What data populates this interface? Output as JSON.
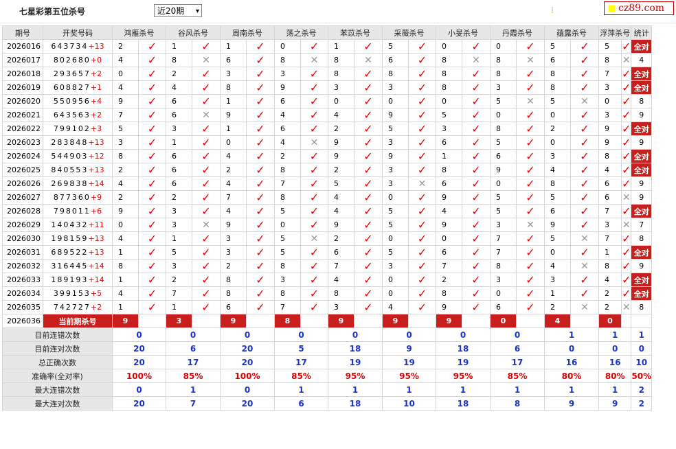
{
  "header": {
    "title": "七星彩第五位杀号",
    "select_value": "近20期",
    "logo_text": "cz89.com"
  },
  "columns": [
    "期号",
    "开奖号码",
    "鸿雁杀号",
    "谷风杀号",
    "周南杀号",
    "荡之杀号",
    "苯苡杀号",
    "采薇杀号",
    "小旻杀号",
    "丹霞杀号",
    "蕴露杀号",
    "浮萍杀号",
    "统计"
  ],
  "hit_symbol": "✓",
  "miss_symbol": "✕",
  "rows": [
    {
      "period": "2026016",
      "digits": "643734",
      "plus": "+13",
      "v": [
        "2",
        "1",
        "1",
        "0",
        "1",
        "5",
        "0",
        "0",
        "5",
        "5"
      ],
      "r": [
        1,
        1,
        1,
        1,
        1,
        1,
        1,
        1,
        1,
        1
      ],
      "stat": "全对"
    },
    {
      "period": "2026017",
      "digits": "802680",
      "plus": "+0",
      "v": [
        "4",
        "8",
        "6",
        "8",
        "8",
        "6",
        "8",
        "8",
        "6",
        "8"
      ],
      "r": [
        1,
        0,
        1,
        0,
        0,
        1,
        0,
        0,
        1,
        0
      ],
      "stat": "4"
    },
    {
      "period": "2026018",
      "digits": "293657",
      "plus": "+2",
      "v": [
        "0",
        "2",
        "3",
        "3",
        "8",
        "8",
        "8",
        "8",
        "8",
        "7"
      ],
      "r": [
        1,
        1,
        1,
        1,
        1,
        1,
        1,
        1,
        1,
        1
      ],
      "stat": "全对"
    },
    {
      "period": "2026019",
      "digits": "608827",
      "plus": "+1",
      "v": [
        "4",
        "4",
        "8",
        "9",
        "3",
        "3",
        "8",
        "3",
        "8",
        "3"
      ],
      "r": [
        1,
        1,
        1,
        1,
        1,
        1,
        1,
        1,
        1,
        1
      ],
      "stat": "全对"
    },
    {
      "period": "2026020",
      "digits": "550956",
      "plus": "+4",
      "v": [
        "9",
        "6",
        "1",
        "6",
        "0",
        "0",
        "0",
        "5",
        "5",
        "0"
      ],
      "r": [
        1,
        1,
        1,
        1,
        1,
        1,
        1,
        0,
        0,
        1
      ],
      "stat": "8"
    },
    {
      "period": "2026021",
      "digits": "643563",
      "plus": "+2",
      "v": [
        "7",
        "6",
        "9",
        "4",
        "4",
        "9",
        "5",
        "0",
        "0",
        "3"
      ],
      "r": [
        1,
        0,
        1,
        1,
        1,
        1,
        1,
        1,
        1,
        1
      ],
      "stat": "9"
    },
    {
      "period": "2026022",
      "digits": "799102",
      "plus": "+3",
      "v": [
        "5",
        "3",
        "1",
        "6",
        "2",
        "5",
        "3",
        "8",
        "2",
        "9"
      ],
      "r": [
        1,
        1,
        1,
        1,
        1,
        1,
        1,
        1,
        1,
        1
      ],
      "stat": "全对"
    },
    {
      "period": "2026023",
      "digits": "283848",
      "plus": "+13",
      "v": [
        "3",
        "1",
        "0",
        "4",
        "9",
        "3",
        "6",
        "5",
        "0",
        "9"
      ],
      "r": [
        1,
        1,
        1,
        0,
        1,
        1,
        1,
        1,
        1,
        1
      ],
      "stat": "9"
    },
    {
      "period": "2026024",
      "digits": "544903",
      "plus": "+12",
      "v": [
        "8",
        "6",
        "4",
        "2",
        "9",
        "9",
        "1",
        "6",
        "3",
        "8"
      ],
      "r": [
        1,
        1,
        1,
        1,
        1,
        1,
        1,
        1,
        1,
        1
      ],
      "stat": "全对"
    },
    {
      "period": "2026025",
      "digits": "840553",
      "plus": "+13",
      "v": [
        "2",
        "6",
        "2",
        "8",
        "2",
        "3",
        "8",
        "9",
        "4",
        "4"
      ],
      "r": [
        1,
        1,
        1,
        1,
        1,
        1,
        1,
        1,
        1,
        1
      ],
      "stat": "全对"
    },
    {
      "period": "2026026",
      "digits": "269838",
      "plus": "+14",
      "v": [
        "4",
        "6",
        "4",
        "7",
        "5",
        "3",
        "6",
        "0",
        "8",
        "6"
      ],
      "r": [
        1,
        1,
        1,
        1,
        1,
        0,
        1,
        1,
        1,
        1
      ],
      "stat": "9"
    },
    {
      "period": "2026027",
      "digits": "877360",
      "plus": "+9",
      "v": [
        "2",
        "2",
        "7",
        "8",
        "4",
        "0",
        "9",
        "5",
        "5",
        "6"
      ],
      "r": [
        1,
        1,
        1,
        1,
        1,
        1,
        1,
        1,
        1,
        0
      ],
      "stat": "9"
    },
    {
      "period": "2026028",
      "digits": "798011",
      "plus": "+6",
      "v": [
        "9",
        "3",
        "4",
        "5",
        "4",
        "5",
        "4",
        "5",
        "6",
        "7"
      ],
      "r": [
        1,
        1,
        1,
        1,
        1,
        1,
        1,
        1,
        1,
        1
      ],
      "stat": "全对"
    },
    {
      "period": "2026029",
      "digits": "140432",
      "plus": "+11",
      "v": [
        "0",
        "3",
        "9",
        "0",
        "9",
        "5",
        "9",
        "3",
        "9",
        "3"
      ],
      "r": [
        1,
        0,
        1,
        1,
        1,
        1,
        1,
        0,
        1,
        0
      ],
      "stat": "7"
    },
    {
      "period": "2026030",
      "digits": "198159",
      "plus": "+13",
      "v": [
        "4",
        "1",
        "3",
        "5",
        "2",
        "0",
        "0",
        "7",
        "5",
        "7"
      ],
      "r": [
        1,
        1,
        1,
        0,
        1,
        1,
        1,
        1,
        0,
        1
      ],
      "stat": "8"
    },
    {
      "period": "2026031",
      "digits": "689522",
      "plus": "+13",
      "v": [
        "1",
        "5",
        "3",
        "5",
        "6",
        "5",
        "6",
        "7",
        "0",
        "1"
      ],
      "r": [
        1,
        1,
        1,
        1,
        1,
        1,
        1,
        1,
        1,
        1
      ],
      "stat": "全对"
    },
    {
      "period": "2026032",
      "digits": "316445",
      "plus": "+14",
      "v": [
        "8",
        "3",
        "2",
        "8",
        "7",
        "3",
        "7",
        "8",
        "4",
        "8"
      ],
      "r": [
        1,
        1,
        1,
        1,
        1,
        1,
        1,
        1,
        0,
        1
      ],
      "stat": "9"
    },
    {
      "period": "2026033",
      "digits": "189193",
      "plus": "+14",
      "v": [
        "1",
        "2",
        "8",
        "3",
        "4",
        "0",
        "2",
        "3",
        "3",
        "4"
      ],
      "r": [
        1,
        1,
        1,
        1,
        1,
        1,
        1,
        1,
        1,
        1
      ],
      "stat": "全对"
    },
    {
      "period": "2026034",
      "digits": "399153",
      "plus": "+5",
      "v": [
        "4",
        "7",
        "8",
        "8",
        "8",
        "0",
        "8",
        "0",
        "1",
        "2"
      ],
      "r": [
        1,
        1,
        1,
        1,
        1,
        1,
        1,
        1,
        1,
        1
      ],
      "stat": "全对"
    },
    {
      "period": "2026035",
      "digits": "742727",
      "plus": "+2",
      "v": [
        "1",
        "1",
        "6",
        "7",
        "3",
        "4",
        "9",
        "6",
        "2",
        "2"
      ],
      "r": [
        1,
        1,
        1,
        1,
        1,
        1,
        1,
        1,
        0,
        0
      ],
      "stat": "8"
    }
  ],
  "current": {
    "period": "2026036",
    "label": "当前期杀号",
    "values": [
      "9",
      "3",
      "9",
      "8",
      "9",
      "9",
      "9",
      "0",
      "4",
      "0"
    ]
  },
  "stats": [
    {
      "label": "目前连错次数",
      "values": [
        "0",
        "0",
        "0",
        "0",
        "0",
        "0",
        "0",
        "0",
        "1",
        "1",
        "1"
      ],
      "red": false
    },
    {
      "label": "目前连对次数",
      "values": [
        "20",
        "6",
        "20",
        "5",
        "18",
        "9",
        "18",
        "6",
        "0",
        "0",
        "0"
      ],
      "red": false
    },
    {
      "label": "总正确次数",
      "values": [
        "20",
        "17",
        "20",
        "17",
        "19",
        "19",
        "19",
        "17",
        "16",
        "16",
        "10"
      ],
      "red": false
    },
    {
      "label": "准确率(全对率)",
      "values": [
        "100%",
        "85%",
        "100%",
        "85%",
        "95%",
        "95%",
        "95%",
        "85%",
        "80%",
        "80%",
        "50%"
      ],
      "red": true
    },
    {
      "label": "最大连错次数",
      "values": [
        "0",
        "1",
        "0",
        "1",
        "1",
        "1",
        "1",
        "1",
        "1",
        "1",
        "2"
      ],
      "red": false
    },
    {
      "label": "最大连对次数",
      "values": [
        "20",
        "7",
        "20",
        "6",
        "18",
        "10",
        "18",
        "8",
        "9",
        "9",
        "2"
      ],
      "red": false
    }
  ]
}
